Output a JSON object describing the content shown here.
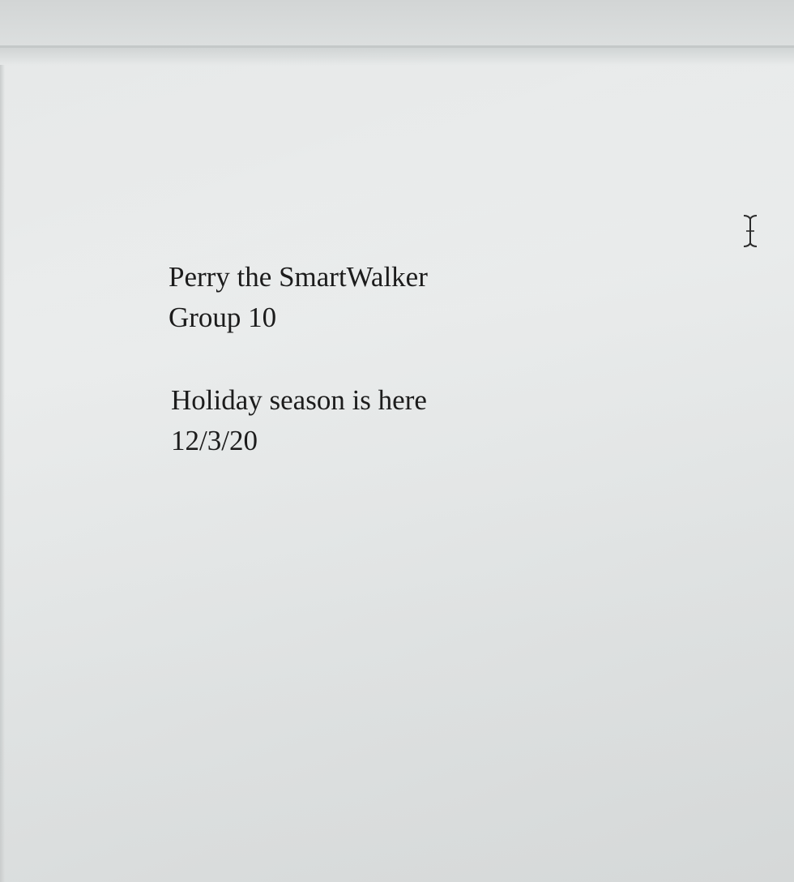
{
  "document": {
    "title_block": {
      "line1": "Perry the SmartWalker",
      "line2": "Group 10"
    },
    "entry_block": {
      "line1": "Holiday season is here",
      "line2": "12/3/20"
    }
  },
  "cursor": {
    "icon": "i-beam-cursor-icon"
  }
}
